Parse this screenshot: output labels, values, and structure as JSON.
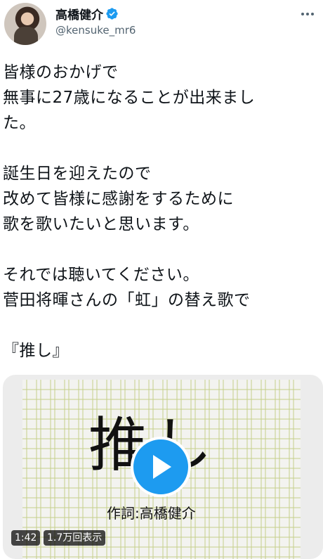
{
  "author": {
    "display_name": "高橋健介",
    "handle": "@kensuke_mr6"
  },
  "tweet": {
    "text": "皆様のおかげで\n無事に27歳になることが出来まし\nた。\n\n誕生日を迎えたので\n改めて皆様に感謝をするために\n歌を歌いたいと思います。\n\nそれでは聴いてください。\n菅田将暉さんの「虹」の替え歌で\n\n『推し』"
  },
  "video": {
    "title": "推し",
    "credit": "作詞:高橋健介",
    "duration": "1:42",
    "views": "1.7万回表示"
  },
  "colors": {
    "accent": "#1d9bf0",
    "secondary_text": "#536471",
    "paper_grid": "#c6cf8a"
  },
  "icons": {
    "verified": "verified-badge-icon",
    "more": "more-dots-icon",
    "play": "play-icon"
  }
}
